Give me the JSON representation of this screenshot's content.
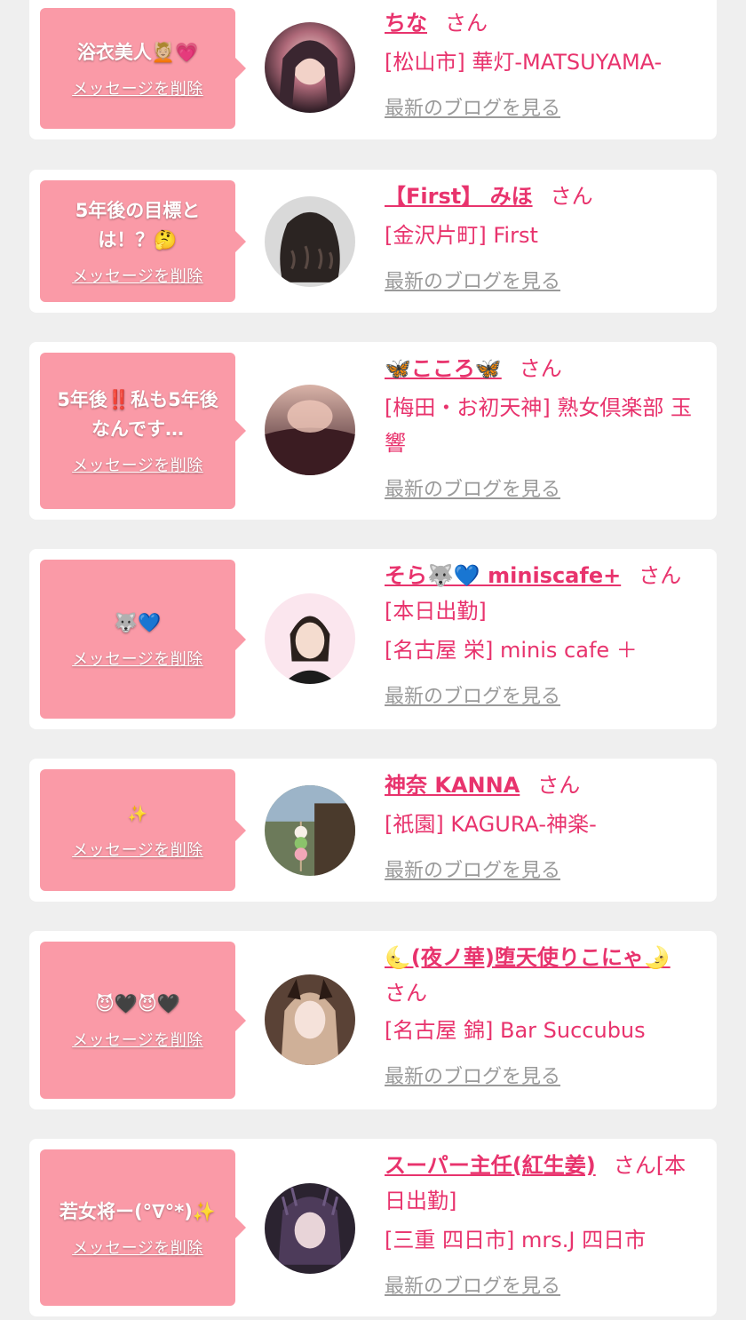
{
  "delete_label": "メッセージを削除",
  "blog_label": "最新のブログを見る",
  "san_label": "さん",
  "cards": [
    {
      "message": "浴衣美人💆🏼💗",
      "name": "ちな",
      "san_suffix": "さん",
      "shop": "[松山市] 華灯-MATSUYAMA-"
    },
    {
      "message": "5年後の目標とは！？🤔",
      "name": "【First】 みほ",
      "san_suffix": "さん",
      "shop": "[金沢片町] First"
    },
    {
      "message": "5年後‼️私も5年後なんです…",
      "name": "🦋こころ🦋",
      "san_suffix": "さん",
      "shop": "[梅田・お初天神] 熟女倶楽部 玉響"
    },
    {
      "message": "🐺💙",
      "name": "そら🐺💙 miniscafe+",
      "san_suffix": "さん[本日出勤]",
      "shop": "[名古屋 栄] minis cafe ＋"
    },
    {
      "message": "✨",
      "name": "神奈 KANNA",
      "san_suffix": "さん",
      "shop": "[祇園] KAGURA-神楽-"
    },
    {
      "message": "😈🖤😈🖤",
      "name": "🌜(夜ノ華)堕天使りこにゃ🌛",
      "san_suffix": "さん",
      "shop": "[名古屋 錦] Bar Succubus"
    },
    {
      "message": "若女将ー(°∇°*)✨",
      "name": "スーパー主任(紅生姜)",
      "san_suffix": "さん[本日出勤]",
      "shop": "[三重 四日市] mrs.J 四日市"
    }
  ],
  "colors": {
    "bubble": "#fa9aa7",
    "name_text": "#e8336d",
    "blog_link": "#9a9a9a",
    "page_bg": "#efefef"
  }
}
